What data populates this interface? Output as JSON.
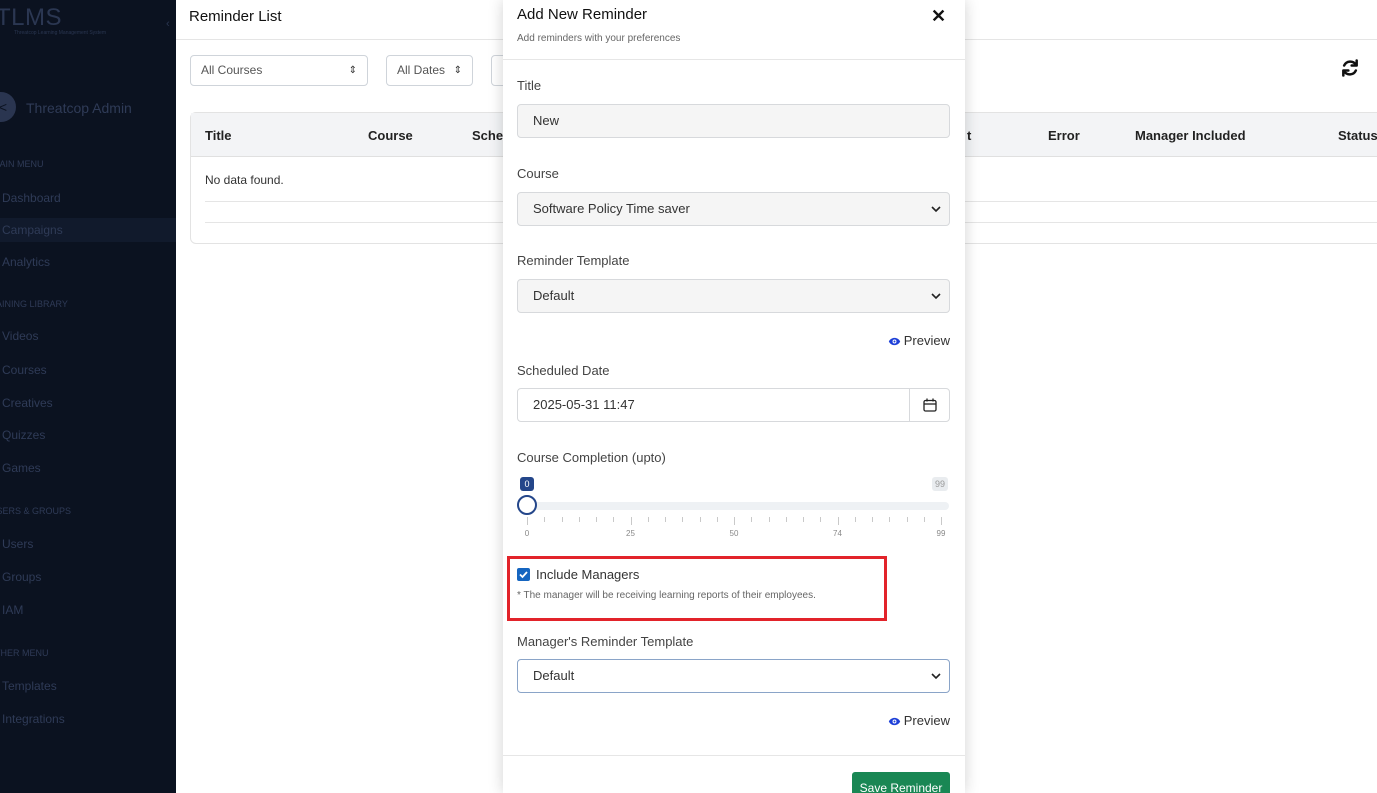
{
  "sidebar": {
    "logo": "TLMS",
    "logo_sub": "Threatcop Learning Management System",
    "collapse_glyph": "‹",
    "user_initial": "<",
    "user_name": "Threatcop Admin",
    "sections": [
      {
        "label": "MAIN MENU"
      },
      {
        "label": "TRAINING LIBRARY"
      },
      {
        "label": "USERS & GROUPS"
      },
      {
        "label": "OTHER MENU"
      }
    ],
    "items": [
      {
        "label": "Dashboard"
      },
      {
        "label": "Campaigns"
      },
      {
        "label": "Analytics"
      },
      {
        "label": "Videos"
      },
      {
        "label": "Courses"
      },
      {
        "label": "Creatives"
      },
      {
        "label": "Quizzes"
      },
      {
        "label": "Games"
      },
      {
        "label": "Users"
      },
      {
        "label": "Groups"
      },
      {
        "label": "IAM"
      },
      {
        "label": "Templates"
      },
      {
        "label": "Integrations"
      }
    ]
  },
  "page": {
    "title": "Reminder List",
    "filters": {
      "courses": "All Courses",
      "dates": "All Dates",
      "caret": "⇕"
    },
    "table": {
      "headers": [
        "Title",
        "Course",
        "Sched",
        "t",
        "Error",
        "Manager Included",
        "Status"
      ],
      "empty_text": "No data found."
    }
  },
  "modal": {
    "title": "Add New Reminder",
    "subtitle": "Add reminders with your preferences",
    "close_glyph": "✕",
    "title_label": "Title",
    "title_value": "New",
    "course_label": "Course",
    "course_value": "Software Policy Time saver",
    "template_label": "Reminder Template",
    "template_value": "Default",
    "preview_label": "Preview",
    "scheduled_label": "Scheduled Date",
    "scheduled_value": "2025-05-31 11:47",
    "completion_label": "Course Completion (upto)",
    "slider": {
      "min": 0,
      "max": 99,
      "value": 0,
      "low_badge": "0",
      "high_badge": "99",
      "tick_labels": [
        "0",
        "25",
        "50",
        "74",
        "99"
      ]
    },
    "include_managers_label": "Include Managers",
    "include_managers_checked": true,
    "include_managers_note": "* The manager will be receiving learning reports of their employees.",
    "manager_template_label": "Manager's Reminder Template",
    "manager_template_value": "Default",
    "manager_preview_label": "Preview",
    "save_label": "Save Reminder"
  },
  "colors": {
    "accent": "#24468a",
    "save": "#198754",
    "highlight": "#e2232a",
    "checkbox": "#1565c0"
  }
}
